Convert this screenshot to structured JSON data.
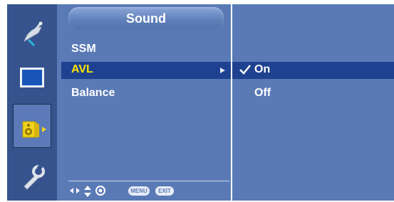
{
  "sidebar": {
    "items": [
      {
        "icon": "satellite-dish-icon",
        "selected": false
      },
      {
        "icon": "monitor-screen-icon",
        "selected": false
      },
      {
        "icon": "speaker-icon",
        "selected": true
      },
      {
        "icon": "wrench-icon",
        "selected": false
      }
    ]
  },
  "menu": {
    "title": "Sound",
    "items": [
      {
        "label": "SSM",
        "active": false
      },
      {
        "label": "AVL",
        "active": true
      },
      {
        "label": "Balance",
        "active": false
      }
    ]
  },
  "options": {
    "items": [
      {
        "label": "On",
        "checked": true
      },
      {
        "label": "Off",
        "checked": false
      }
    ]
  },
  "nav_bar": {
    "menu_label": "MENU",
    "exit_label": "EXIT"
  },
  "colors": {
    "panel": "#5a7ab6",
    "sidebar": "#36538e",
    "highlight": "#1f4290",
    "active_text": "#ffe600"
  }
}
